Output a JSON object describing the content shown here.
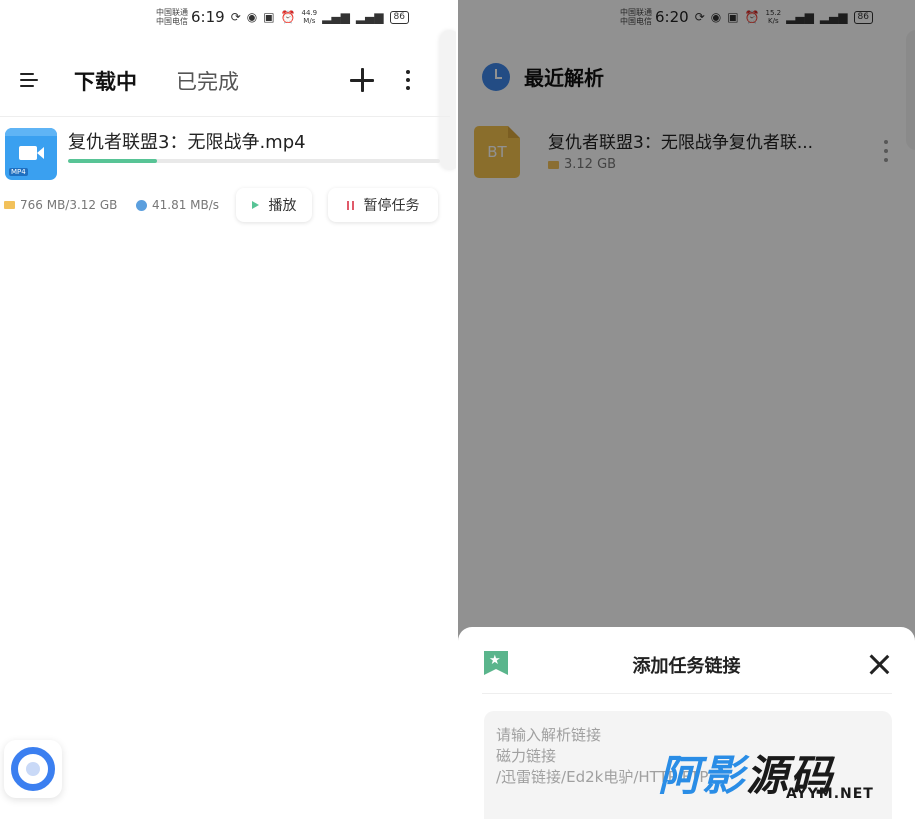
{
  "left": {
    "status": {
      "carrier_top": "中国联通",
      "carrier_bottom": "中国电信",
      "time": "6:19",
      "speed_value": "44.9",
      "speed_unit": "M/s",
      "battery": "86"
    },
    "tabs": [
      {
        "label": "下载中",
        "active": true
      },
      {
        "label": "已完成",
        "active": false
      }
    ],
    "task": {
      "file_type": "MP4",
      "title": "复仇者联盟3：无限战争.mp4",
      "progress_fraction": 0.24,
      "size_text": "766 MB/3.12 GB",
      "speed_text": "41.81 MB/s",
      "play_label": "播放",
      "pause_label": "暂停任务"
    }
  },
  "right": {
    "status": {
      "carrier_top": "中国联通",
      "carrier_bottom": "中国电信",
      "time": "6:20",
      "speed_value": "15.2",
      "speed_unit": "K/s",
      "battery": "86"
    },
    "header_title": "最近解析",
    "recent": {
      "icon_text": "BT",
      "title": "复仇者联盟3：无限战争复仇者联...",
      "size": "3.12 GB"
    },
    "sheet": {
      "title": "添加任务链接",
      "placeholder": "请输入解析链接\n磁力链接\n/迅雷链接/Ed2k电驴/HTTP/FTP"
    }
  },
  "watermark": {
    "text_blue": "阿影",
    "text_dark": "源码",
    "url": "AYYM.NET"
  },
  "colors": {
    "accent_blue": "#3b7ff0",
    "progress_green": "#58c496",
    "pause_red": "#e05a6a",
    "bt_yellow": "#f3c24e"
  }
}
